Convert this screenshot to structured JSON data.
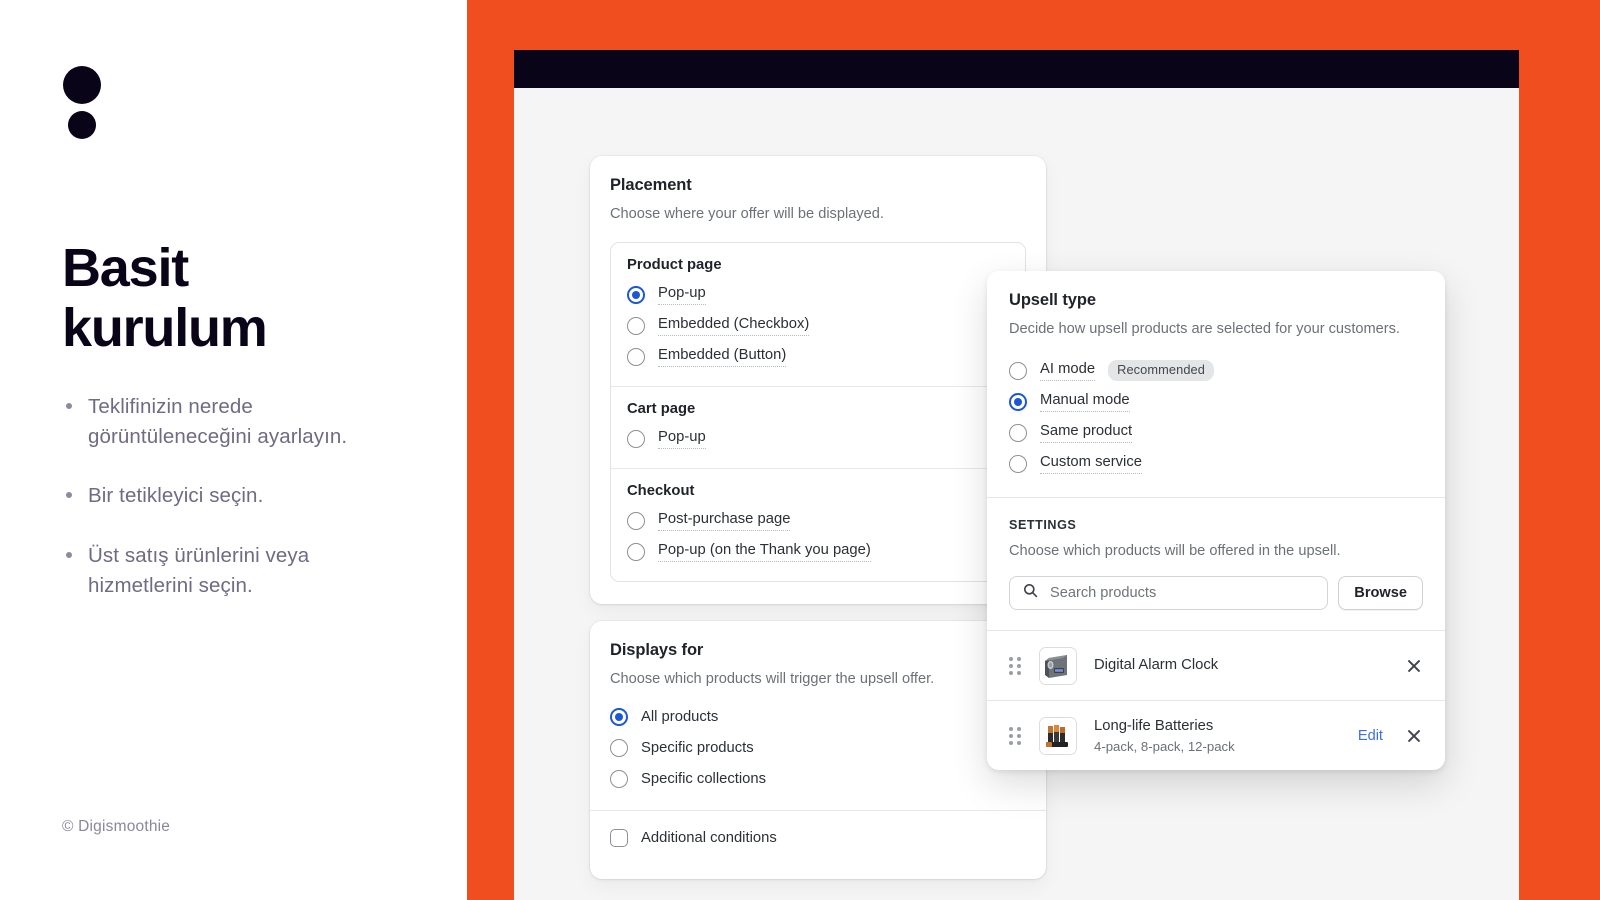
{
  "brand": {
    "logo_icon": "two-dots-logo",
    "headline_line1": "Basit",
    "headline_line2": "kurulum",
    "copyright": "© Digismoothie",
    "accent_color": "#F04E1E",
    "ink_color": "#0A0418"
  },
  "bullets": [
    "Teklifinizin nerede görüntüleneceğini ayarlayın.",
    "Bir tetikleyici seçin.",
    "Üst satış ürünlerini veya hizmetlerini seçin."
  ],
  "placement_card": {
    "title": "Placement",
    "subtitle": "Choose where your offer will be displayed.",
    "groups": [
      {
        "title": "Product page",
        "options": [
          {
            "label": "Pop-up",
            "checked": true
          },
          {
            "label": "Embedded (Checkbox)",
            "checked": false
          },
          {
            "label": "Embedded (Button)",
            "checked": false
          }
        ]
      },
      {
        "title": "Cart page",
        "options": [
          {
            "label": "Pop-up",
            "checked": false
          }
        ]
      },
      {
        "title": "Checkout",
        "options": [
          {
            "label": "Post-purchase page",
            "checked": false
          },
          {
            "label": "Pop-up (on the Thank you page)",
            "checked": false
          }
        ]
      }
    ]
  },
  "displays_card": {
    "title": "Displays for",
    "subtitle": "Choose which products will trigger the upsell offer.",
    "options": [
      {
        "label": "All products",
        "checked": true
      },
      {
        "label": "Specific products",
        "checked": false
      },
      {
        "label": "Specific collections",
        "checked": false
      }
    ],
    "checkbox_label": "Additional conditions",
    "checkbox_checked": false
  },
  "upsell_panel": {
    "title": "Upsell type",
    "subtitle": "Decide how upsell products are selected for your customers.",
    "options": [
      {
        "label": "AI mode",
        "checked": false,
        "badge": "Recommended"
      },
      {
        "label": "Manual mode",
        "checked": true,
        "badge": ""
      },
      {
        "label": "Same product",
        "checked": false,
        "badge": ""
      },
      {
        "label": "Custom service",
        "checked": false,
        "badge": ""
      }
    ],
    "settings": {
      "label": "SETTINGS",
      "description": "Choose which products will be offered in the upsell.",
      "search_placeholder": "Search products",
      "search_value": "",
      "search_icon": "search-icon",
      "browse_label": "Browse"
    },
    "products": [
      {
        "name": "Digital Alarm Clock",
        "variants": "",
        "edit_label": "",
        "thumb": "alarm-clock",
        "remove_icon": "close-icon",
        "drag_icon": "drag-handle-icon"
      },
      {
        "name": "Long-life Batteries",
        "variants": "4-pack, 8-pack, 12-pack",
        "edit_label": "Edit",
        "thumb": "batteries",
        "remove_icon": "close-icon",
        "drag_icon": "drag-handle-icon"
      }
    ]
  }
}
